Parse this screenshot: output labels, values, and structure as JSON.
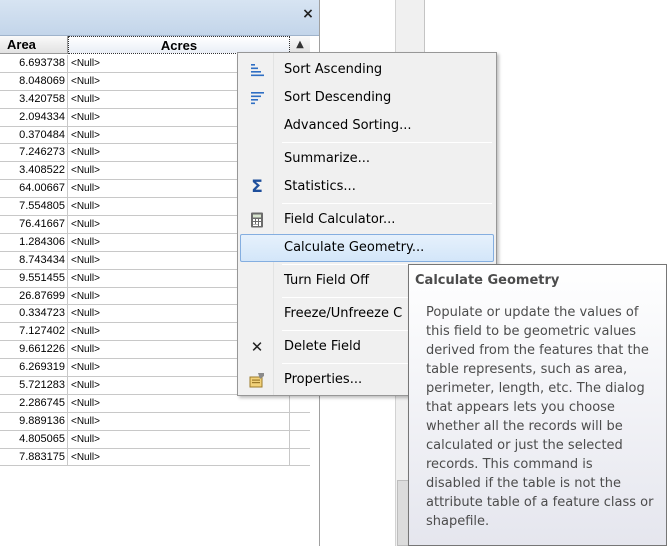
{
  "table": {
    "close_glyph": "×",
    "headers": {
      "area": "Area",
      "acres": "Acres"
    },
    "scroll_up_glyph": "▲",
    "rows": [
      {
        "area": "6.693738",
        "acres": "<Null>"
      },
      {
        "area": "8.048069",
        "acres": "<Null>"
      },
      {
        "area": "3.420758",
        "acres": "<Null>"
      },
      {
        "area": "2.094334",
        "acres": "<Null>"
      },
      {
        "area": "0.370484",
        "acres": "<Null>"
      },
      {
        "area": "7.246273",
        "acres": "<Null>"
      },
      {
        "area": "3.408522",
        "acres": "<Null>"
      },
      {
        "area": "64.00667",
        "acres": "<Null>"
      },
      {
        "area": "7.554805",
        "acres": "<Null>"
      },
      {
        "area": "76.41667",
        "acres": "<Null>"
      },
      {
        "area": "1.284306",
        "acres": "<Null>"
      },
      {
        "area": "8.743434",
        "acres": "<Null>"
      },
      {
        "area": "9.551455",
        "acres": "<Null>"
      },
      {
        "area": "26.87699",
        "acres": "<Null>"
      },
      {
        "area": "0.334723",
        "acres": "<Null>"
      },
      {
        "area": "7.127402",
        "acres": "<Null>"
      },
      {
        "area": "9.661226",
        "acres": "<Null>"
      },
      {
        "area": "6.269319",
        "acres": "<Null>"
      },
      {
        "area": "5.721283",
        "acres": "<Null>"
      },
      {
        "area": "2.286745",
        "acres": "<Null>"
      },
      {
        "area": "9.889136",
        "acres": "<Null>"
      },
      {
        "area": "4.805065",
        "acres": "<Null>"
      },
      {
        "area": "7.883175",
        "acres": "<Null>"
      }
    ]
  },
  "context_menu": {
    "items": {
      "sort_ascending": {
        "label": "Sort Ascending",
        "icon": "sort-ascending-icon"
      },
      "sort_descending": {
        "label": "Sort Descending",
        "icon": "sort-descending-icon"
      },
      "advanced_sorting": {
        "label": "Advanced Sorting..."
      },
      "summarize": {
        "label": "Summarize..."
      },
      "statistics": {
        "label": "Statistics...",
        "icon": "sigma-icon"
      },
      "field_calculator": {
        "label": "Field Calculator...",
        "icon": "calculator-icon"
      },
      "calculate_geometry": {
        "label": "Calculate Geometry...",
        "highlighted": true
      },
      "turn_field_off": {
        "label": "Turn Field Off"
      },
      "freeze_unfreeze": {
        "label": "Freeze/Unfreeze C"
      },
      "delete_field": {
        "label": "Delete Field",
        "icon": "delete-x-icon"
      },
      "properties": {
        "label": "Properties...",
        "icon": "properties-icon"
      }
    },
    "icon_glyphs": {
      "sigma": "Σ",
      "delete": "✕"
    }
  },
  "tooltip": {
    "title": "Calculate Geometry",
    "lines": [
      "Populate or update the values of",
      "this field to be geometric values",
      "derived from the features that the",
      "table represents, such as area,",
      "perimeter, length, etc. The dialog",
      "that appears lets you choose",
      "whether all the records will be",
      "calculated or just the selected",
      "records. This command is",
      "disabled if the table is not the",
      "attribute table of a feature class or",
      "shapefile."
    ]
  },
  "colors": {
    "title_bar": "#c3d5ea",
    "menu_background": "#f0f0f0",
    "menu_highlight": "#d3e6f9",
    "menu_highlight_border": "#84aee0",
    "sigma_icon": "#1e4f9c",
    "delete_icon": "#222222",
    "tooltip_text": "#4c4c4c"
  }
}
